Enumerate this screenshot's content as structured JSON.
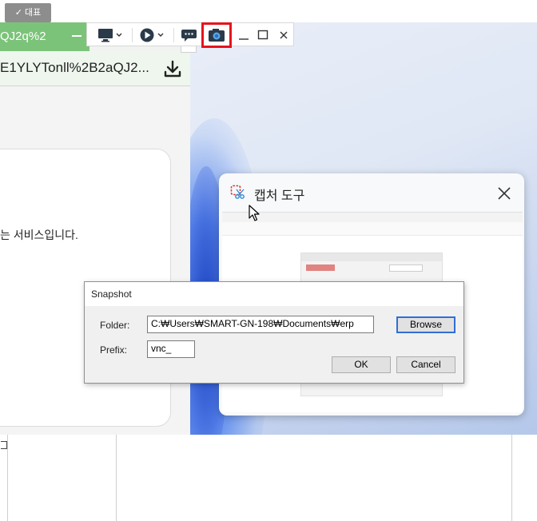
{
  "badge": {
    "label": "대표"
  },
  "left_browser": {
    "tab_title": "QJ2q%2",
    "address_text": "E1YLYTonll%2B2aQJ2...",
    "body_text": "는 서비스입니다."
  },
  "capture_tool": {
    "title": "캡처 도구"
  },
  "snapshot_dialog": {
    "title": "Snapshot",
    "folder_label": "Folder:",
    "folder_value": "C:₩Users₩SMART-GN-198₩Documents₩erp",
    "prefix_label": "Prefix:",
    "prefix_value": "vnc_",
    "browse_label": "Browse",
    "ok_label": "OK",
    "cancel_label": "Cancel"
  },
  "toolbar": {
    "icons": [
      "monitor-icon",
      "play-icon",
      "chat-icon",
      "camera-snapshot-icon",
      "minimize-icon",
      "maximize-icon",
      "close-icon"
    ]
  },
  "colors": {
    "tab_green": "#7cc37a",
    "highlight_red": "#e3141c",
    "browse_blue": "#2f6fd6"
  }
}
